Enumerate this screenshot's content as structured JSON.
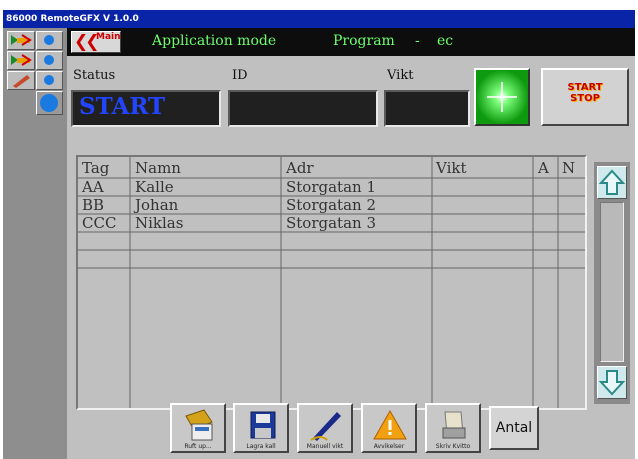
{
  "window": {
    "title": "86000 RemoteGFX V 1.0.0"
  },
  "header": {
    "main_button_label": "Main",
    "mode_label": "Application mode",
    "program_label": "Program",
    "program_sep": "-",
    "program_value": "ec"
  },
  "fields": {
    "status_label": "Status",
    "status_value": "START",
    "id_label": "ID",
    "id_value": "",
    "vikt_label": "Vikt",
    "vikt_value": ""
  },
  "indicator": {
    "color": "#3cff3c"
  },
  "startstop": {
    "label_line1": "START",
    "label_line2": "STOP"
  },
  "table": {
    "columns": [
      "Tag",
      "Namn",
      "Adr",
      "Vikt",
      "A",
      "N"
    ],
    "rows": [
      [
        "AA",
        "Kalle",
        "Storgatan 1",
        "",
        "",
        ""
      ],
      [
        "BB",
        "Johan",
        "Storgatan 2",
        "",
        "",
        ""
      ],
      [
        "CCC",
        "Niklas",
        "Storgatan 3",
        "",
        "",
        ""
      ]
    ]
  },
  "toolbar": {
    "buttons": [
      {
        "label": "Ruft up...",
        "icon": "folder-icon"
      },
      {
        "label": "Lagra kall",
        "icon": "floppy-disk-icon"
      },
      {
        "label": "Manuell vikt",
        "icon": "pen-icon"
      },
      {
        "label": "Avvikelser",
        "icon": "warning-icon"
      },
      {
        "label": "Skriv Kvitto",
        "icon": "printer-icon"
      }
    ],
    "antal_label": "Antal"
  },
  "sidebar": {
    "icons": [
      "flag-arrow-icon",
      "circle-blue-icon",
      "flag-arrow-icon",
      "circle-blue-icon",
      "pencil-icon",
      "circle-blue-icon",
      "circle-blue-icon"
    ]
  },
  "colors": {
    "title_bar": "#0a24a8",
    "status_text": "#2345ff",
    "mode_text": "#6cff6c",
    "startstop_text": "#c40000"
  }
}
